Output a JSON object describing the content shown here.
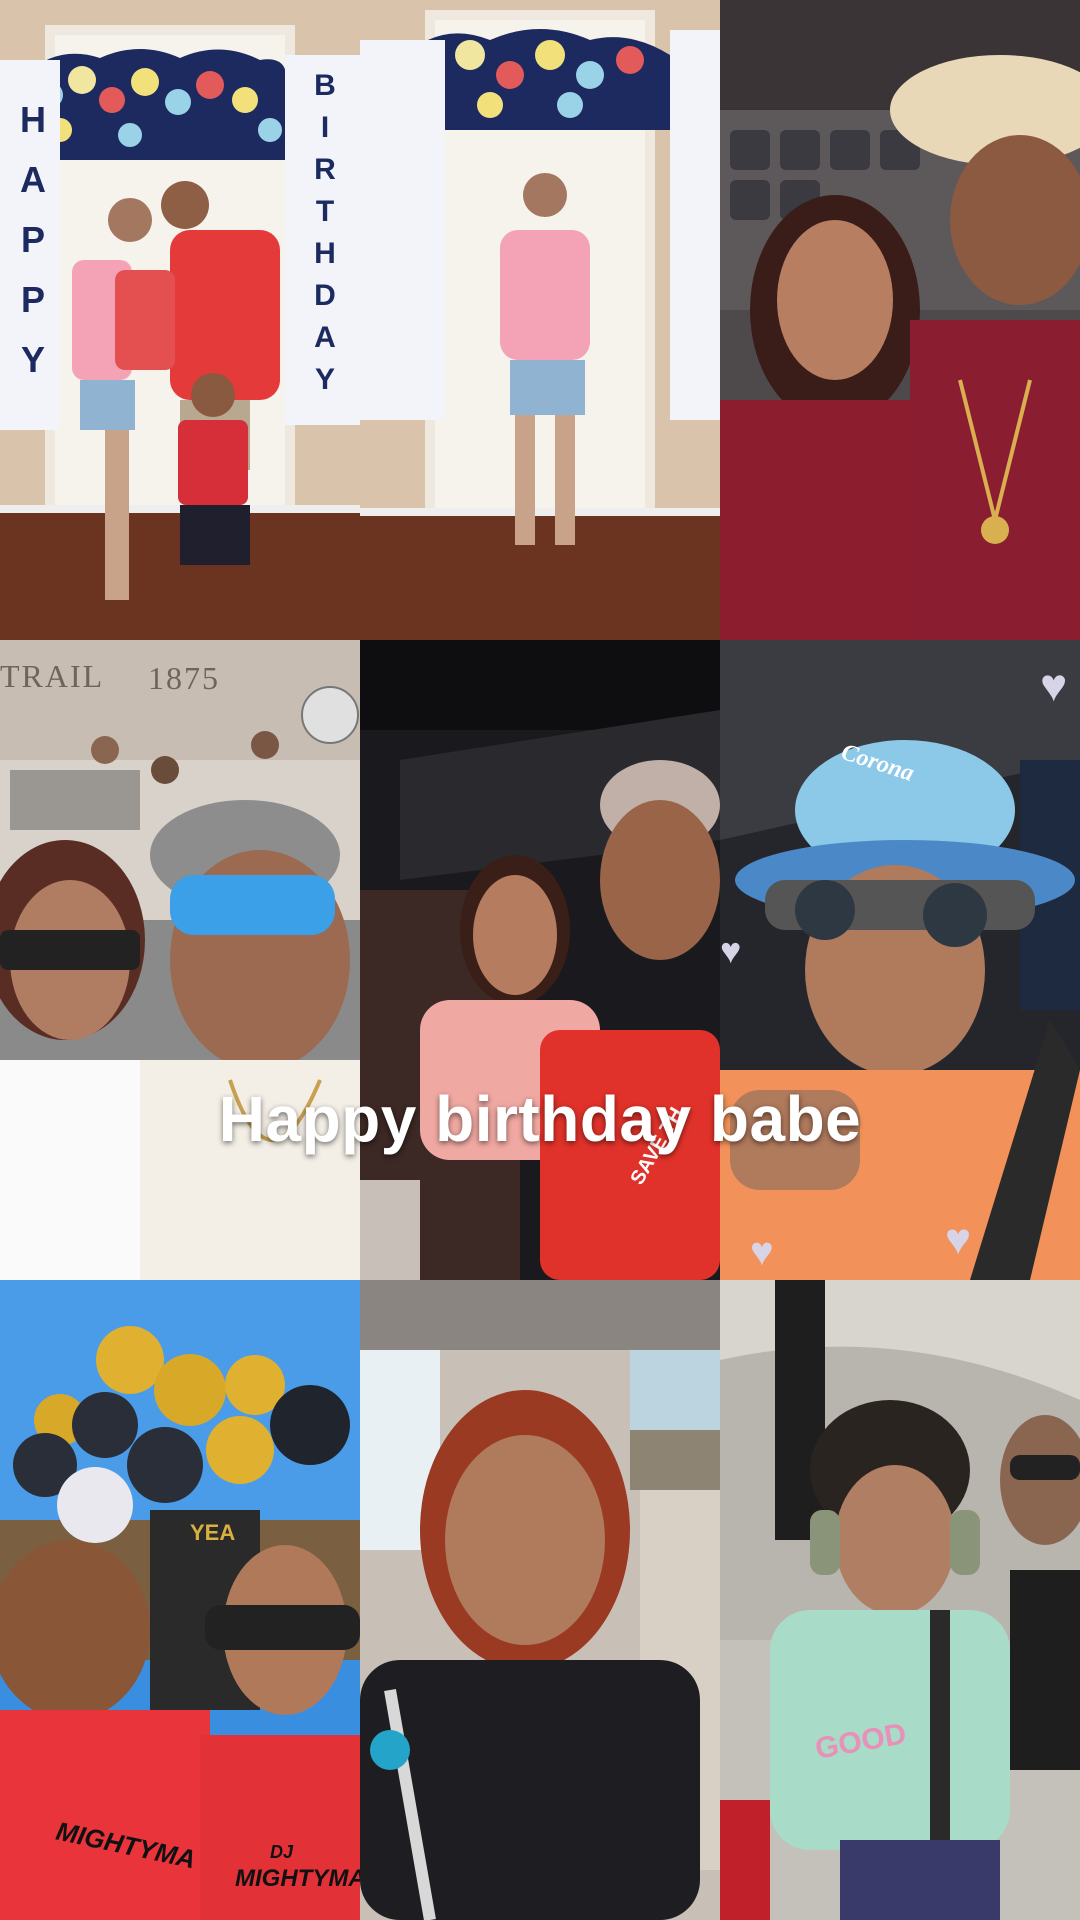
{
  "caption": "Happy birthday babe",
  "banner": {
    "left_letters": [
      "H",
      "A",
      "P",
      "P",
      "Y"
    ],
    "right_letters": [
      "B",
      "I",
      "R",
      "T",
      "H",
      "D",
      "A",
      "Y"
    ]
  },
  "wall_inscription": {
    "word": "TRAIL",
    "year": "1875"
  },
  "shirt_text": {
    "sleeve": "SAVE TH",
    "mighty_left": "MIGHTYMA",
    "mighty_right_top": "DJ",
    "mighty_right": "MIGHTYMA",
    "kid_shirt": "GOOD"
  },
  "hat_brand": "Corona",
  "party_sign": "YEA",
  "stickers": [
    "heart-icon",
    "heart-icon",
    "heart-icon",
    "heart-icon"
  ]
}
